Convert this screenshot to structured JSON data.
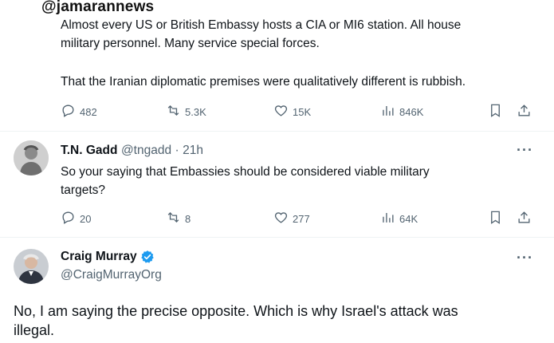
{
  "watermark": "@jamarannews",
  "tweet1": {
    "line1": "Almost every US or British Embassy hosts a CIA or MI6 station. All house",
    "line2": "military personnel.  Many service special forces.",
    "line3": "That the Iranian diplomatic premises were qualitatively different is rubbish.",
    "replies": "482",
    "reposts": "5.3K",
    "likes": "15K",
    "views": "846K"
  },
  "tweet2": {
    "name": "T.N. Gadd",
    "handle": "@tngadd",
    "separator": "·",
    "time": "21h",
    "line1": "So your saying that Embassies should be considered viable military",
    "line2": "targets?",
    "replies": "20",
    "reposts": "8",
    "likes": "277",
    "views": "64K",
    "more": "···"
  },
  "tweet3": {
    "name": "Craig Murray",
    "handle": "@CraigMurrayOrg",
    "line1": "No, I am saying the precise opposite. Which is why Israel's attack was",
    "line2": "illegal.",
    "more": "···",
    "verified_color": "#1d9bf0"
  },
  "icons": {
    "reply": "reply-icon",
    "repost": "repost-icon",
    "like": "heart-icon",
    "views": "views-chart-icon",
    "bookmark": "bookmark-icon",
    "share": "share-icon"
  }
}
